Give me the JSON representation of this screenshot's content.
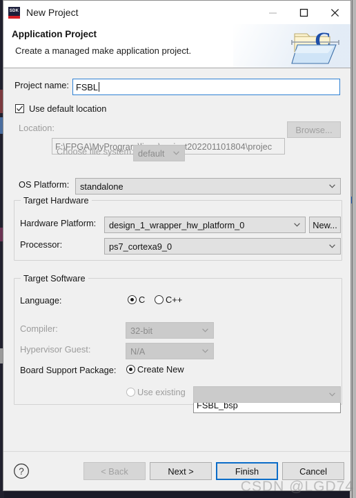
{
  "window": {
    "title": "New Project",
    "app_icon": "sdk-icon",
    "app_icon_text": "SDK",
    "controls": {
      "minimize": "minimize-icon",
      "maximize": "maximize-icon",
      "close": "close-icon"
    }
  },
  "banner": {
    "title": "Application Project",
    "subtitle": "Create a managed make application project.",
    "icon": "c-project-folder-icon"
  },
  "form": {
    "project_name_label": "Project name:",
    "project_name_value": "FSBL",
    "use_default_location_label": "Use default location",
    "use_default_location_checked": true,
    "location_label": "Location:",
    "location_value": "F:\\FPGA\\MyProgram\\linux\\project202201101804\\projec",
    "browse_label": "Browse...",
    "choose_file_system_label": "Choose file system:",
    "choose_file_system_value": "default",
    "os_platform_label": "OS Platform:",
    "os_platform_value": "standalone"
  },
  "target_hardware": {
    "group_title": "Target Hardware",
    "hardware_platform_label": "Hardware Platform:",
    "hardware_platform_value": "design_1_wrapper_hw_platform_0",
    "new_button_label": "New...",
    "processor_label": "Processor:",
    "processor_value": "ps7_cortexa9_0"
  },
  "target_software": {
    "group_title": "Target Software",
    "language_label": "Language:",
    "language_options": [
      {
        "label": "C",
        "selected": true
      },
      {
        "label": "C++",
        "selected": false
      }
    ],
    "compiler_label": "Compiler:",
    "compiler_value": "32-bit",
    "hypervisor_guest_label": "Hypervisor Guest:",
    "hypervisor_guest_value": "N/A",
    "bsp_label": "Board Support Package:",
    "bsp_create_new_label": "Create New",
    "bsp_create_new_selected": true,
    "bsp_create_new_value": "FSBL_bsp",
    "bsp_use_existing_label": "Use existing",
    "bsp_use_existing_selected": false,
    "bsp_use_existing_value": ""
  },
  "footer": {
    "help_icon": "help-icon",
    "back_label": "< Back",
    "next_label": "Next >",
    "finish_label": "Finish",
    "cancel_label": "Cancel"
  },
  "watermark": {
    "text": "CSDN @LGD74"
  },
  "colors": {
    "accent": "#0a6cc8",
    "focus_border": "#2d7fd3",
    "dialog_bg": "#f0f0f0",
    "sdk_red": "#d42027",
    "sdk_navy": "#1c1f3b"
  }
}
